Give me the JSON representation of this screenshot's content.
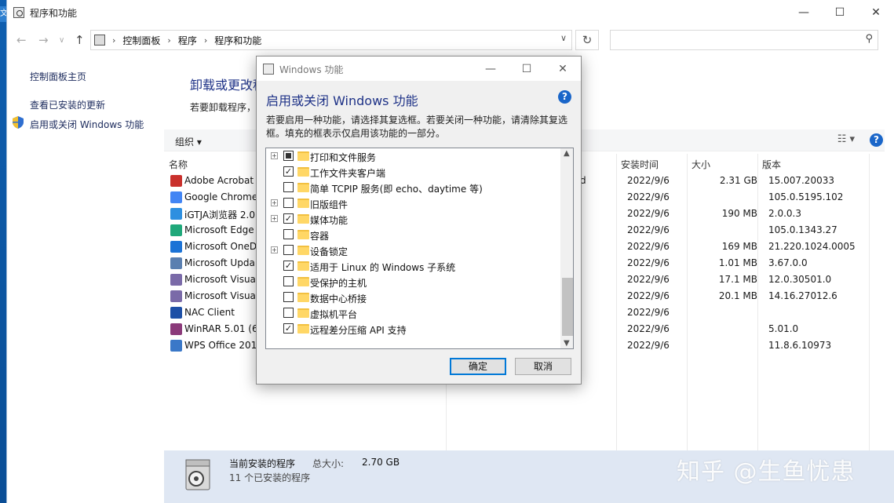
{
  "desktop": {
    "tab_char": "文"
  },
  "window": {
    "title": "程序和功能",
    "controls": {
      "minimize": "—",
      "maximize": "☐",
      "close": "✕"
    }
  },
  "address": {
    "crumbs": [
      "控制面板",
      "程序",
      "程序和功能"
    ]
  },
  "search": {
    "placeholder": ""
  },
  "leftnav": {
    "home": "控制面板主页",
    "updates": "查看已安装的更新",
    "features": "启用或关闭 Windows 功能"
  },
  "main": {
    "title": "卸载或更改程",
    "subtitle": "若要卸载程序，"
  },
  "toolbar": {
    "organize": "组织 ▾",
    "view_icon": "view-options-icon",
    "help": "?"
  },
  "columns": {
    "name": "名称",
    "installed": "安装时间",
    "size": "大小",
    "version": "版本"
  },
  "programs": [
    {
      "name": "Adobe Acrobat",
      "tail": "d",
      "date": "2022/9/6",
      "size": "2.31 GB",
      "version": "15.007.20033",
      "icon_color": "#c9302c"
    },
    {
      "name": "Google Chrome",
      "tail": "",
      "date": "2022/9/6",
      "size": "",
      "version": "105.0.5195.102",
      "icon_color": "#4285f4"
    },
    {
      "name": "iGTJA浏览器 2.0.",
      "tail": "",
      "date": "2022/9/6",
      "size": "190 MB",
      "version": "2.0.0.3",
      "icon_color": "#2d8fe0"
    },
    {
      "name": "Microsoft Edge",
      "tail": "",
      "date": "2022/9/6",
      "size": "",
      "version": "105.0.1343.27",
      "icon_color": "#1fa87a"
    },
    {
      "name": "Microsoft OneD",
      "tail": "",
      "date": "2022/9/6",
      "size": "169 MB",
      "version": "21.220.1024.0005",
      "icon_color": "#1c73d6"
    },
    {
      "name": "Microsoft Upda",
      "tail": "",
      "date": "2022/9/6",
      "size": "1.01 MB",
      "version": "3.67.0.0",
      "icon_color": "#5a7fb0"
    },
    {
      "name": "Microsoft Visua",
      "tail": "",
      "date": "2022/9/6",
      "size": "17.1 MB",
      "version": "12.0.30501.0",
      "icon_color": "#7a6aa8"
    },
    {
      "name": "Microsoft Visua",
      "tail": "",
      "date": "2022/9/6",
      "size": "20.1 MB",
      "version": "14.16.27012.6",
      "icon_color": "#7a6aa8"
    },
    {
      "name": "NAC Client",
      "tail": "",
      "date": "2022/9/6",
      "size": "",
      "version": "",
      "icon_color": "#1d4fa6"
    },
    {
      "name": "WinRAR 5.01 (64",
      "tail": "",
      "date": "2022/9/6",
      "size": "",
      "version": "5.01.0",
      "icon_color": "#8b3a7a"
    },
    {
      "name": "WPS Office 2019",
      "tail": "",
      "date": "2022/9/6",
      "size": "",
      "version": "11.8.6.10973",
      "icon_color": "#3a78c8"
    }
  ],
  "status": {
    "label": "当前安装的程序",
    "total_label": "总大小:",
    "total_value": "2.70 GB",
    "count": "11 个已安装的程序"
  },
  "watermark": "知乎 @生鱼忧患",
  "dialog": {
    "title": "Windows 功能",
    "heading": "启用或关闭 Windows 功能",
    "help": "?",
    "description": "若要启用一种功能，请选择其复选框。若要关闭一种功能，请清除其复选框。填充的框表示仅启用该功能的一部分。",
    "features": [
      {
        "label": "打印和文件服务",
        "state": "partial",
        "expandable": true
      },
      {
        "label": "工作文件夹客户端",
        "state": "checked",
        "expandable": false
      },
      {
        "label": "简单 TCPIP 服务(即 echo、daytime 等)",
        "state": "unchecked",
        "expandable": false
      },
      {
        "label": "旧版组件",
        "state": "unchecked",
        "expandable": true
      },
      {
        "label": "媒体功能",
        "state": "checked",
        "expandable": true
      },
      {
        "label": "容器",
        "state": "unchecked",
        "expandable": false
      },
      {
        "label": "设备锁定",
        "state": "unchecked",
        "expandable": true
      },
      {
        "label": "适用于 Linux 的 Windows 子系统",
        "state": "checked",
        "expandable": false
      },
      {
        "label": "受保护的主机",
        "state": "unchecked",
        "expandable": false
      },
      {
        "label": "数据中心桥接",
        "state": "unchecked",
        "expandable": false
      },
      {
        "label": "虚拟机平台",
        "state": "unchecked",
        "expandable": false
      },
      {
        "label": "远程差分压缩 API 支持",
        "state": "checked",
        "expandable": false
      }
    ],
    "ok": "确定",
    "cancel": "取消"
  }
}
